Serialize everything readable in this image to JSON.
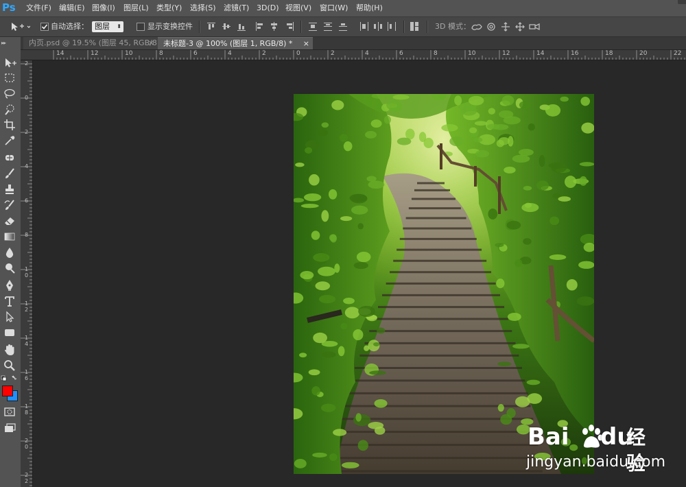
{
  "app": {
    "logo": "Ps"
  },
  "menu": [
    {
      "id": "file",
      "label": "文件(F)"
    },
    {
      "id": "edit",
      "label": "编辑(E)"
    },
    {
      "id": "image",
      "label": "图像(I)"
    },
    {
      "id": "layer",
      "label": "图层(L)"
    },
    {
      "id": "type",
      "label": "类型(Y)"
    },
    {
      "id": "select",
      "label": "选择(S)"
    },
    {
      "id": "filter",
      "label": "滤镜(T)"
    },
    {
      "id": "3d",
      "label": "3D(D)"
    },
    {
      "id": "view",
      "label": "视图(V)"
    },
    {
      "id": "window",
      "label": "窗口(W)"
    },
    {
      "id": "help",
      "label": "帮助(H)"
    }
  ],
  "options": {
    "auto_select_label": "自动选择：",
    "auto_select_checked": true,
    "layer_select_value": "图层",
    "show_transform_label": "显示变换控件",
    "show_transform_checked": false,
    "mode_3d_label": "3D 模式："
  },
  "tabs": [
    {
      "label": "内页.psd @ 19.5% (图层 45, RGB/8)",
      "close": "×",
      "active": false
    },
    {
      "label": "未标题-3 @ 100% (图层 1, RGB/8) *",
      "close": "×",
      "active": true
    }
  ],
  "rulers": {
    "top": [
      "14",
      "12",
      "10",
      "8",
      "6",
      "4",
      "2",
      "0",
      "2",
      "4",
      "6",
      "8",
      "10",
      "12",
      "14",
      "16",
      "18",
      "20",
      "22"
    ],
    "left": [
      "2",
      "0",
      "2",
      "4",
      "6",
      "8",
      "10",
      "12",
      "14",
      "16",
      "18",
      "20",
      "22"
    ]
  },
  "colors": {
    "foreground": "#ff0000",
    "background": "#1e90ff"
  },
  "watermark": {
    "brand_bai": "Bai",
    "brand_du": "du",
    "brand_cn": "经验",
    "url": "jingyan.baidu.com"
  }
}
